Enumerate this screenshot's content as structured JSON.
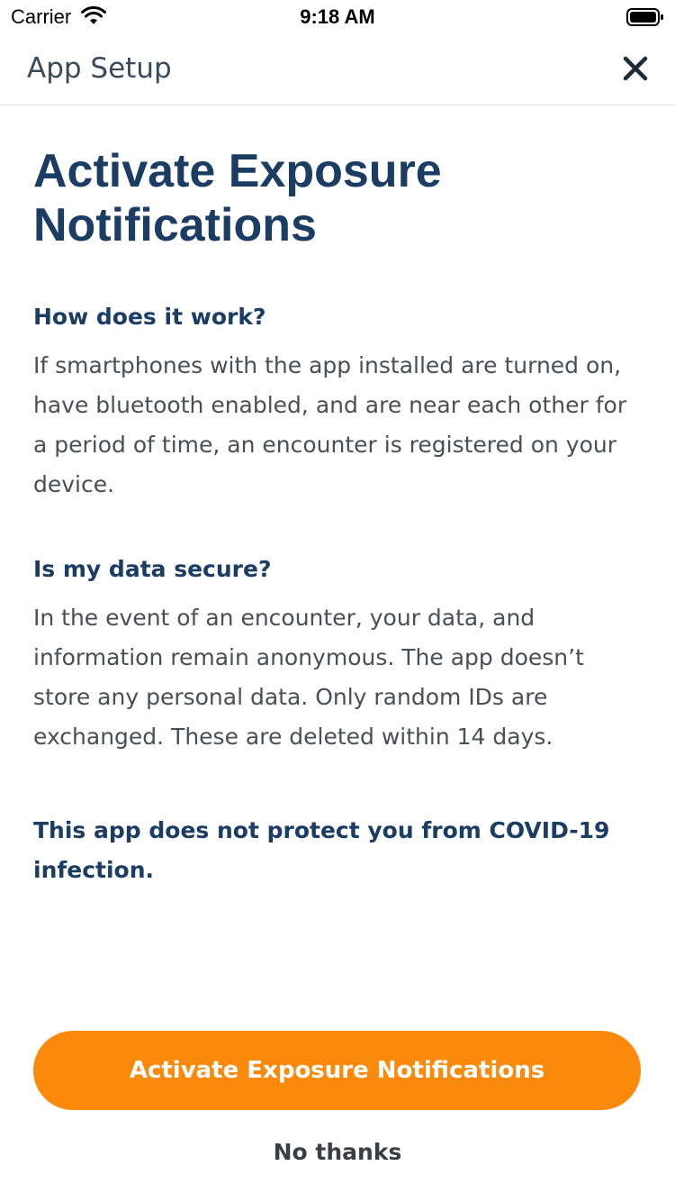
{
  "status_bar": {
    "carrier": "Carrier",
    "time": "9:18 AM"
  },
  "nav": {
    "title": "App Setup",
    "close_icon": "close-icon"
  },
  "page": {
    "title": "Activate Exposure Notifications",
    "sections": [
      {
        "heading": "How does it work?",
        "body": "If smartphones with the app installed are turned on, have bluetooth enabled, and are near each other for a period of time, an encounter is registered on your device."
      },
      {
        "heading": "Is my data secure?",
        "body": "In the event of an encounter, your data, and information remain anonymous. The app doesn’t store any personal data. Only random IDs are exchanged. These are deleted within 14 days."
      }
    ],
    "warning": "This app does not protect you from COVID-19 infection."
  },
  "actions": {
    "primary_label": "Activate Exposure Notifications",
    "secondary_label": "No thanks"
  },
  "colors": {
    "accent": "#fb8a0a",
    "heading": "#1b3c63",
    "body": "#4a4f56"
  }
}
